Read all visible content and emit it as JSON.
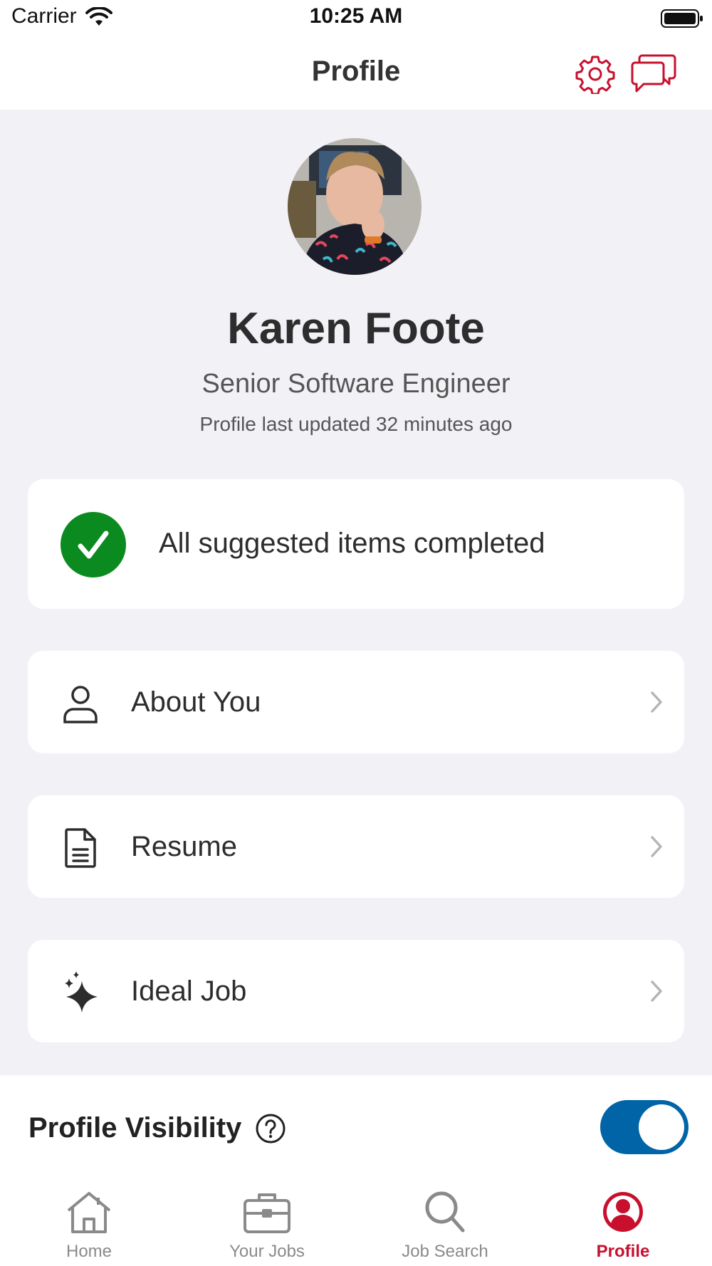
{
  "status_bar": {
    "carrier": "Carrier",
    "time": "10:25 AM"
  },
  "header": {
    "title": "Profile",
    "icons": [
      "gear-icon",
      "chat-bubbles-icon"
    ]
  },
  "profile": {
    "name": "Karen Foote",
    "job_title": "Senior Software Engineer",
    "last_updated": "Profile last updated 32 minutes ago"
  },
  "completion": {
    "text": "All suggested items completed",
    "icon": "checkmark-icon"
  },
  "sections": [
    {
      "label": "About You",
      "icon": "person-icon"
    },
    {
      "label": "Resume",
      "icon": "document-icon"
    },
    {
      "label": "Ideal Job",
      "icon": "sparkles-icon"
    }
  ],
  "visibility": {
    "label": "Profile Visibility",
    "enabled": true
  },
  "tabs": [
    {
      "label": "Home",
      "icon": "home-icon",
      "active": false
    },
    {
      "label": "Your Jobs",
      "icon": "briefcase-icon",
      "active": false
    },
    {
      "label": "Job Search",
      "icon": "search-icon",
      "active": false
    },
    {
      "label": "Profile",
      "icon": "profile-icon",
      "active": true
    }
  ],
  "colors": {
    "accent_red": "#c8102e",
    "toggle_blue": "#0064a6",
    "success_green": "#0b8a1f",
    "background": "#f2f1f6"
  }
}
